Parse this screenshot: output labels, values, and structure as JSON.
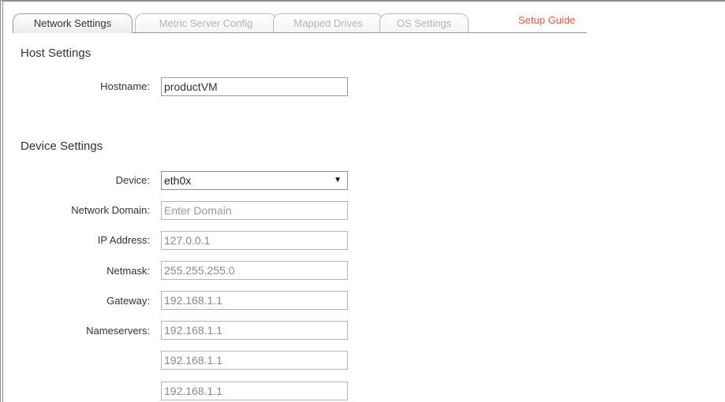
{
  "tabs": [
    {
      "label": "Network Settings",
      "active": true
    },
    {
      "label": "Metric Server Config",
      "active": false
    },
    {
      "label": "Mapped Drives",
      "active": false
    },
    {
      "label": "OS Settings",
      "active": false
    }
  ],
  "setup_guide_label": "Setup Guide",
  "host_settings": {
    "title": "Host Settings",
    "hostname_label": "Hostname:",
    "hostname_value": "productVM"
  },
  "device_settings": {
    "title": "Device Settings",
    "device_label": "Device:",
    "device_value": "eth0x",
    "device_arrow_icon": "down-triangle-icon",
    "network_domain_label": "Network Domain:",
    "network_domain_placeholder": "Enter Domain",
    "ip_address_label": "IP Address:",
    "ip_address_value": "127.0.0.1",
    "netmask_label": "Netmask:",
    "netmask_value": "255.255.255.0",
    "gateway_label": "Gateway:",
    "gateway_value": "192.168.1.1",
    "nameservers_label": "Nameservers:",
    "nameservers": [
      "192.168.1.1",
      "192.168.1.1",
      "192.168.1.1"
    ]
  },
  "colors": {
    "accent_link": "#e05c4a",
    "border": "#b5b5b5",
    "muted_text": "#8a8a8a"
  }
}
